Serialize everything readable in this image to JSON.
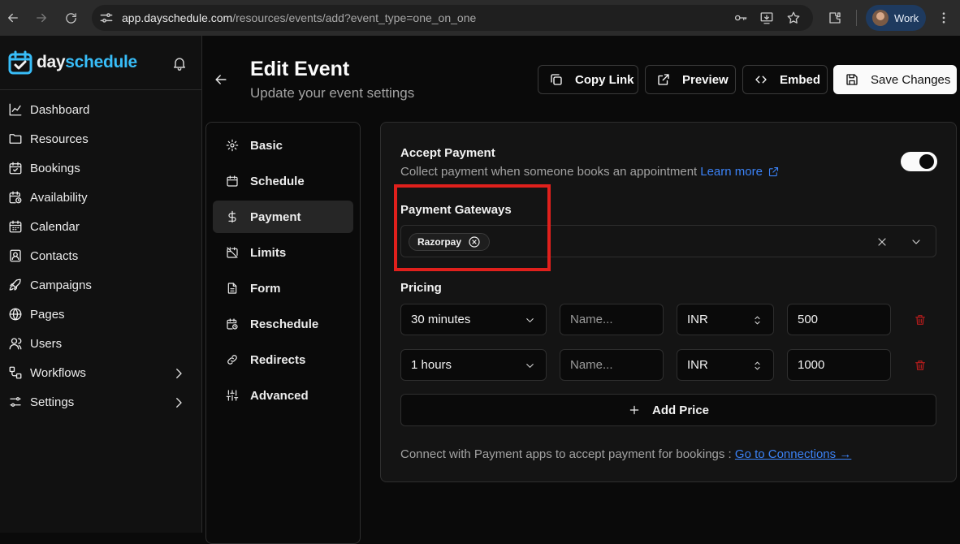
{
  "browser": {
    "url_host": "app.dayschedule.com",
    "url_path": "/resources/events/add?event_type=one_on_one",
    "profile_name": "Work"
  },
  "sidebar": {
    "brand_part1": "day",
    "brand_part2": "schedule",
    "items": [
      {
        "label": "Dashboard",
        "icon": "chart-line-icon"
      },
      {
        "label": "Resources",
        "icon": "folder-icon"
      },
      {
        "label": "Bookings",
        "icon": "calendar-check-icon"
      },
      {
        "label": "Availability",
        "icon": "calendar-clock-icon"
      },
      {
        "label": "Calendar",
        "icon": "calendar-icon"
      },
      {
        "label": "Contacts",
        "icon": "contact-icon"
      },
      {
        "label": "Campaigns",
        "icon": "rocket-icon"
      },
      {
        "label": "Pages",
        "icon": "globe-icon"
      },
      {
        "label": "Users",
        "icon": "users-icon"
      },
      {
        "label": "Workflows",
        "icon": "workflow-icon"
      },
      {
        "label": "Settings",
        "icon": "settings-sliders-icon"
      }
    ]
  },
  "header": {
    "title": "Edit Event",
    "subtitle": "Update your event settings",
    "copy_link": "Copy Link",
    "preview": "Preview",
    "embed": "Embed",
    "save": "Save Changes"
  },
  "tabs": [
    {
      "label": "Basic",
      "icon": "gear-icon"
    },
    {
      "label": "Schedule",
      "icon": "calendar-icon"
    },
    {
      "label": "Payment",
      "icon": "dollar-icon",
      "active": true
    },
    {
      "label": "Limits",
      "icon": "calendar-off-icon"
    },
    {
      "label": "Form",
      "icon": "file-text-icon"
    },
    {
      "label": "Reschedule",
      "icon": "calendar-clock-icon"
    },
    {
      "label": "Redirects",
      "icon": "link-icon"
    },
    {
      "label": "Advanced",
      "icon": "sliders-icon"
    }
  ],
  "payment": {
    "accept_title": "Accept Payment",
    "accept_desc": "Collect payment when someone books an appointment",
    "learn_more": "Learn more",
    "accept_enabled": true,
    "gateways_label": "Payment Gateways",
    "gateways": [
      "Razorpay"
    ],
    "pricing_label": "Pricing",
    "prices": [
      {
        "duration": "30 minutes",
        "name_placeholder": "Name...",
        "currency": "INR",
        "amount": "500"
      },
      {
        "duration": "1 hours",
        "name_placeholder": "Name...",
        "currency": "INR",
        "amount": "1000"
      }
    ],
    "add_price": "Add Price",
    "connect_note": "Connect with Payment apps to accept payment for bookings :",
    "connect_link": "Go to Connections →"
  },
  "colors": {
    "accent_blue": "#3b82f6",
    "brand_cyan": "#38bdf8",
    "highlight_red": "#e0201c",
    "delete_red": "#b91c1c"
  }
}
